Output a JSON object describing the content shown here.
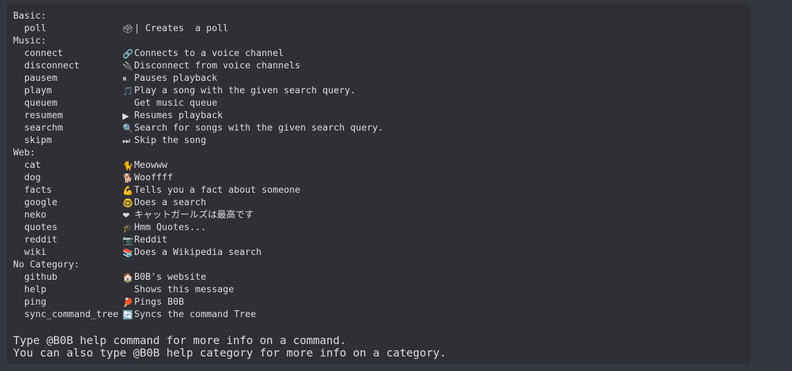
{
  "embed": {
    "accent_color": "#3a3d44",
    "background_color": "#2e3035",
    "outer_background_color": "#34373e",
    "text_color": "#dcddde"
  },
  "sections": [
    {
      "heading": "Basic:",
      "commands": [
        {
          "name": "poll",
          "icon": "ballot-box-emoji",
          "glyph": "🗳",
          "desc": "| Creates  a poll"
        }
      ]
    },
    {
      "heading": "Music:",
      "commands": [
        {
          "name": "connect",
          "icon": "link-emoji",
          "glyph": "🔗",
          "desc": "Connects to a voice channel"
        },
        {
          "name": "disconnect",
          "icon": "plug-emoji",
          "glyph": "🔌",
          "desc": "Disconnect from voice channels"
        },
        {
          "name": "pausem",
          "icon": "pause-button-emoji",
          "glyph": "⏸",
          "desc": "Pauses playback"
        },
        {
          "name": "playm",
          "icon": "musical-notes-emoji",
          "glyph": "🎵",
          "desc": "Play a song with the given search query."
        },
        {
          "name": "queuem",
          "icon": "none",
          "glyph": "",
          "desc": "Get music queue"
        },
        {
          "name": "resumem",
          "icon": "play-button-emoji",
          "glyph": "▶",
          "desc": "Resumes playback"
        },
        {
          "name": "searchm",
          "icon": "magnifying-glass-emoji",
          "glyph": "🔍",
          "desc": "Search for songs with the given search query."
        },
        {
          "name": "skipm",
          "icon": "next-track-emoji",
          "glyph": "⏭",
          "desc": "Skip the song"
        }
      ]
    },
    {
      "heading": "Web:",
      "commands": [
        {
          "name": "cat",
          "icon": "cat-emoji",
          "glyph": "🐈",
          "desc": "Meowww"
        },
        {
          "name": "dog",
          "icon": "dog-emoji",
          "glyph": "🐕",
          "desc": "Wooffff"
        },
        {
          "name": "facts",
          "icon": "flexed-biceps-emoji",
          "glyph": "💪",
          "desc": "Tells you a fact about someone"
        },
        {
          "name": "google",
          "icon": "nerd-face-emoji",
          "glyph": "🤓",
          "desc": "Does a search"
        },
        {
          "name": "neko",
          "icon": "red-heart-emoji",
          "glyph": "❤",
          "desc": "キャットガールズは最高です"
        },
        {
          "name": "quotes",
          "icon": "graduation-cap-emoji",
          "glyph": "🎓",
          "desc": "Hmm Quotes..."
        },
        {
          "name": "reddit",
          "icon": "camera-emoji",
          "glyph": "📷",
          "desc": "Reddit"
        },
        {
          "name": "wiki",
          "icon": "books-emoji",
          "glyph": "📚",
          "desc": "Does a Wikipedia search"
        }
      ]
    },
    {
      "heading": "No Category:",
      "commands": [
        {
          "name": "github",
          "icon": "house-emoji",
          "glyph": "🏠",
          "desc": "B0B's website"
        },
        {
          "name": "help",
          "icon": "none",
          "glyph": "",
          "desc": "Shows this message"
        },
        {
          "name": "ping",
          "icon": "ping-pong-emoji",
          "glyph": "🏓",
          "desc": "Pings B0B"
        },
        {
          "name": "sync_command_tree",
          "icon": "counterclockwise-arrows-emoji",
          "glyph": "🔄",
          "desc": "Syncs the command Tree"
        }
      ]
    }
  ],
  "footer": {
    "line1": "Type @B0B help command for more info on a command.",
    "line2": "You can also type @B0B help category for more info on a category."
  }
}
